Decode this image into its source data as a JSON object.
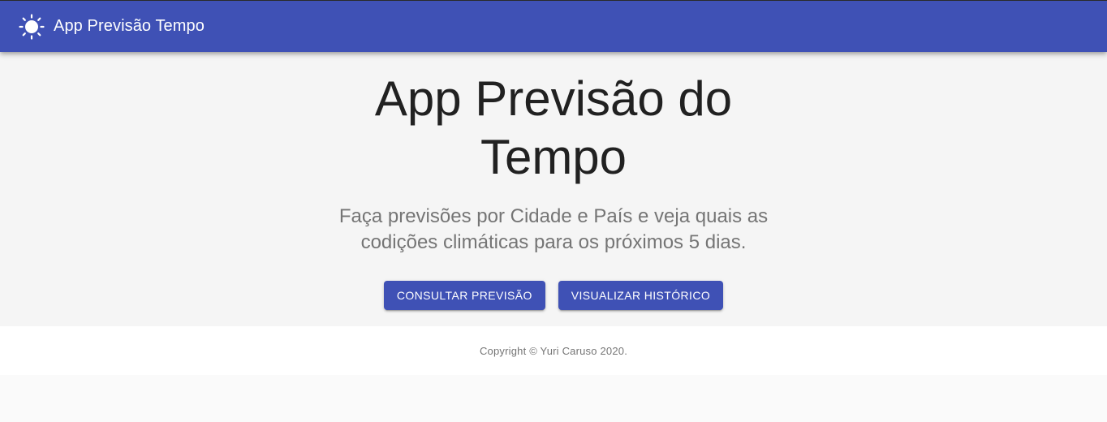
{
  "appbar": {
    "icon": "sun-icon",
    "title": "App Previsão Tempo"
  },
  "hero": {
    "title": "App Previsão do Tempo",
    "subtitle": "Faça previsões por Cidade e País e veja quais as codições climáticas para os próximos 5 dias."
  },
  "actions": {
    "consult_label": "Consultar Previsão",
    "history_label": "Visualizar Histórico"
  },
  "footer": {
    "copyright": "Copyright © Yuri Caruso 2020."
  },
  "colors": {
    "primary": "#3f51b5",
    "hero_bg": "#f5f5f5",
    "footer_bg": "#ffffff",
    "page_bg": "#fafafa"
  }
}
